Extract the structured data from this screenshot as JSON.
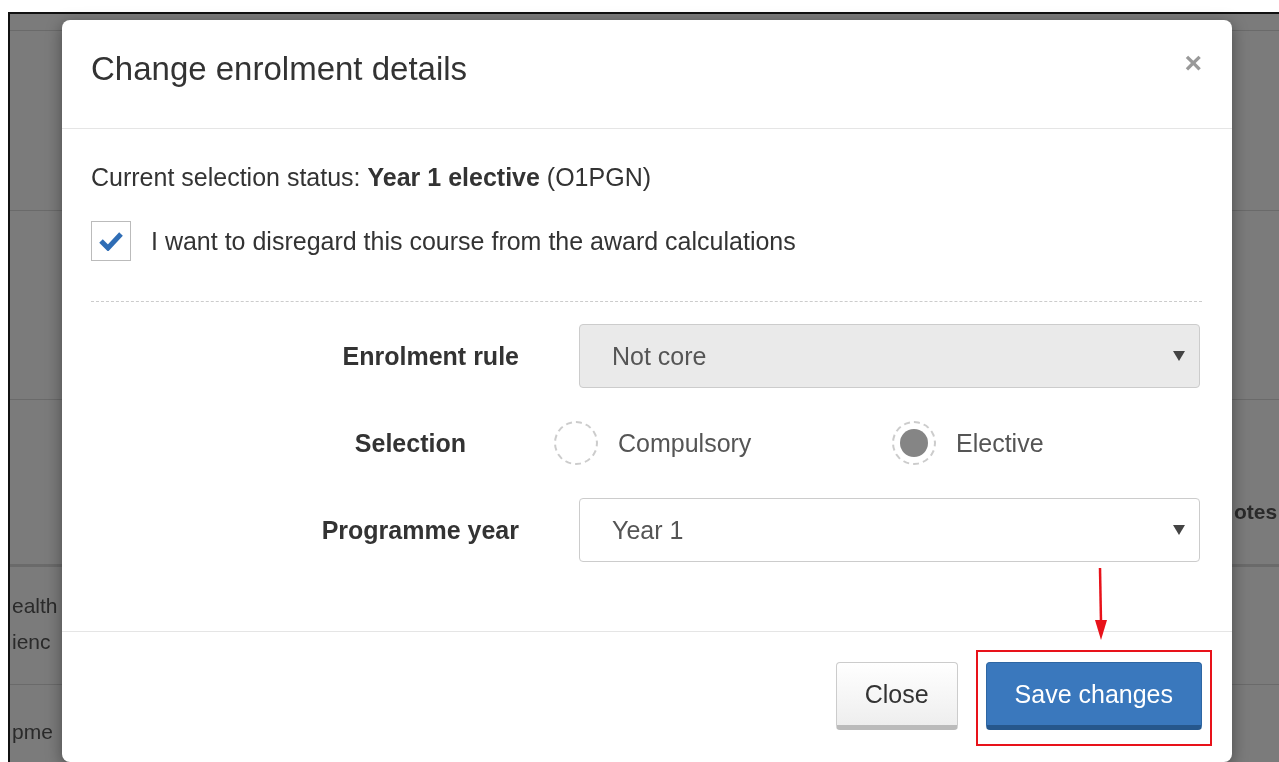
{
  "background": {
    "texts": [
      {
        "text": "otes"
      },
      {
        "text": "ealth"
      },
      {
        "text": "ienc"
      },
      {
        "text": "pme"
      }
    ]
  },
  "dialog": {
    "title": "Change enrolment details",
    "close": "×",
    "status": "Current selection status: **Year 1 elective** (O1PGN)",
    "disregard": {
      "label": "I want to disregard this course from the award calculations",
      "checked": true
    },
    "fields": [
      {
        "kind": "select",
        "label": "Enrolment rule",
        "value": "Not core",
        "disabled": true
      },
      {
        "kind": "radio",
        "label": "Selection",
        "options": [
          {
            "label": "Compulsory",
            "selected": false
          },
          {
            "label": "Elective",
            "selected": true
          }
        ]
      },
      {
        "kind": "select",
        "label": "Programme year",
        "value": "Year 1",
        "disabled": false
      }
    ],
    "buttons": [
      {
        "label": "Close",
        "kind": "default",
        "highlighted": false
      },
      {
        "label": "Save changes",
        "kind": "primary",
        "highlighted": true
      }
    ]
  }
}
